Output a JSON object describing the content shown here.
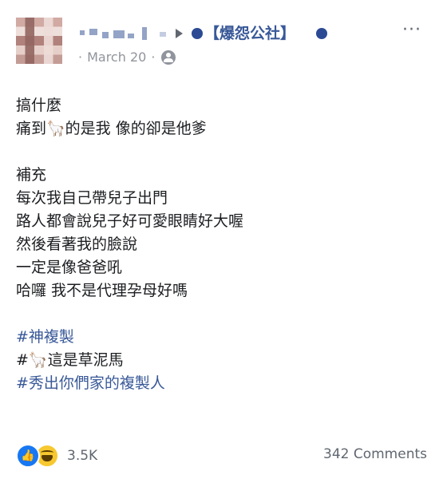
{
  "post": {
    "group_name": "【爆怨公社】",
    "date": "March 20",
    "meta_separator": "·",
    "more_label": "···",
    "lines": [
      {
        "text": "搞什麼",
        "type": "text"
      },
      {
        "text": "痛到🦙的是我 像的卻是他爹",
        "type": "text"
      },
      {
        "text": "",
        "type": "blank"
      },
      {
        "text": "補充",
        "type": "text"
      },
      {
        "text": "每次我自己帶兒子出門",
        "type": "text"
      },
      {
        "text": "路人都會說兒子好可愛眼睛好大喔",
        "type": "text"
      },
      {
        "text": "然後看著我的臉說",
        "type": "text"
      },
      {
        "text": "一定是像爸爸吼",
        "type": "text"
      },
      {
        "text": "哈囉 我不是代理孕母好嗎",
        "type": "text"
      },
      {
        "text": "",
        "type": "blank"
      },
      {
        "text": "#神複製",
        "type": "tag"
      },
      {
        "text": "#🦙這是草泥馬",
        "type": "text"
      },
      {
        "text": "#秀出你們家的複製人",
        "type": "tag"
      }
    ],
    "reactions_count": "3.5K",
    "comments_count": "342 Comments",
    "icons": {
      "avatar": "avatar-blurred",
      "audience": "group-audience-icon",
      "like": "like-reaction-icon",
      "haha": "haha-reaction-icon",
      "more": "more-options-icon"
    },
    "colors": {
      "link": "#385898",
      "meta": "#90949c",
      "like_blue": "#1877f2",
      "haha_yellow": "#f7c82f"
    }
  }
}
